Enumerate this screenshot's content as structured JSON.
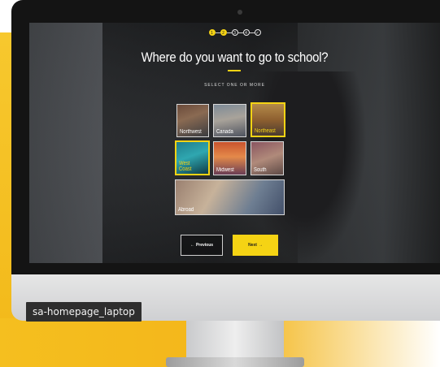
{
  "caption": "sa-homepage_laptop",
  "wizard": {
    "steps": [
      "1",
      "2",
      "3",
      "4",
      "✓"
    ],
    "active_steps": [
      0,
      1
    ],
    "title": "Where do you want to go to school?",
    "subtitle": "SELECT ONE OR MORE",
    "options": [
      {
        "label": "Northwest",
        "selected": false
      },
      {
        "label": "Canada",
        "selected": false
      },
      {
        "label": "Northeast",
        "selected": true
      },
      {
        "label": "West Coast",
        "selected": true
      },
      {
        "label": "Midwest",
        "selected": false
      },
      {
        "label": "South",
        "selected": false
      },
      {
        "label": "Abroad",
        "selected": false
      }
    ],
    "prev_label": "Previous",
    "next_label": "Next",
    "prev_icon": "arrow-left-icon",
    "next_icon": "arrow-right-icon"
  },
  "colors": {
    "accent": "#f5d314",
    "background_yellow": "#f3b51a"
  }
}
